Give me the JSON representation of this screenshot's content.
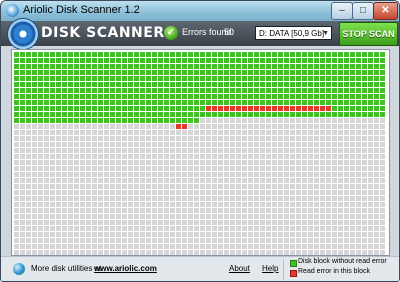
{
  "window": {
    "title": "Ariolic Disk Scanner 1.2",
    "min_glyph": "–",
    "max_glyph": "□",
    "close_glyph": "✕"
  },
  "toolbar": {
    "logo_text": "DISK SCANNER",
    "errors_label": "Errors found:",
    "errors_count": "50",
    "drive_value": "D: DATA [50,9 Gb]",
    "stop_label": "STOP SCAN"
  },
  "scan_grid": {
    "columns": 62,
    "rows": 34,
    "scanned_full_rows": 11,
    "scanned_partial_cols": 31,
    "colors": {
      "ok": "#43c027",
      "error": "#e03a2c",
      "unscanned": "#d6d6d6"
    },
    "error_blocks": [
      [
        9,
        32
      ],
      [
        9,
        33
      ],
      [
        9,
        34
      ],
      [
        9,
        35
      ],
      [
        9,
        36
      ],
      [
        9,
        37
      ],
      [
        9,
        38
      ],
      [
        9,
        39
      ],
      [
        9,
        40
      ],
      [
        9,
        41
      ],
      [
        9,
        42
      ],
      [
        9,
        43
      ],
      [
        9,
        44
      ],
      [
        9,
        45
      ],
      [
        9,
        46
      ],
      [
        9,
        47
      ],
      [
        9,
        48
      ],
      [
        9,
        49
      ],
      [
        9,
        50
      ],
      [
        9,
        51
      ],
      [
        9,
        52
      ],
      [
        12,
        27
      ],
      [
        12,
        28
      ]
    ]
  },
  "status": {
    "more_text": "More disk utilities at",
    "site_link": "www.ariolic.com",
    "about": "About",
    "help": "Help",
    "legend_ok": "Disk block without read error",
    "legend_error": "Read error in this block"
  },
  "icons": {
    "app": "disk-scanner-app-icon",
    "logo": "gear-disk-icon",
    "errors": "check-circle-icon",
    "globe": "globe-icon"
  }
}
